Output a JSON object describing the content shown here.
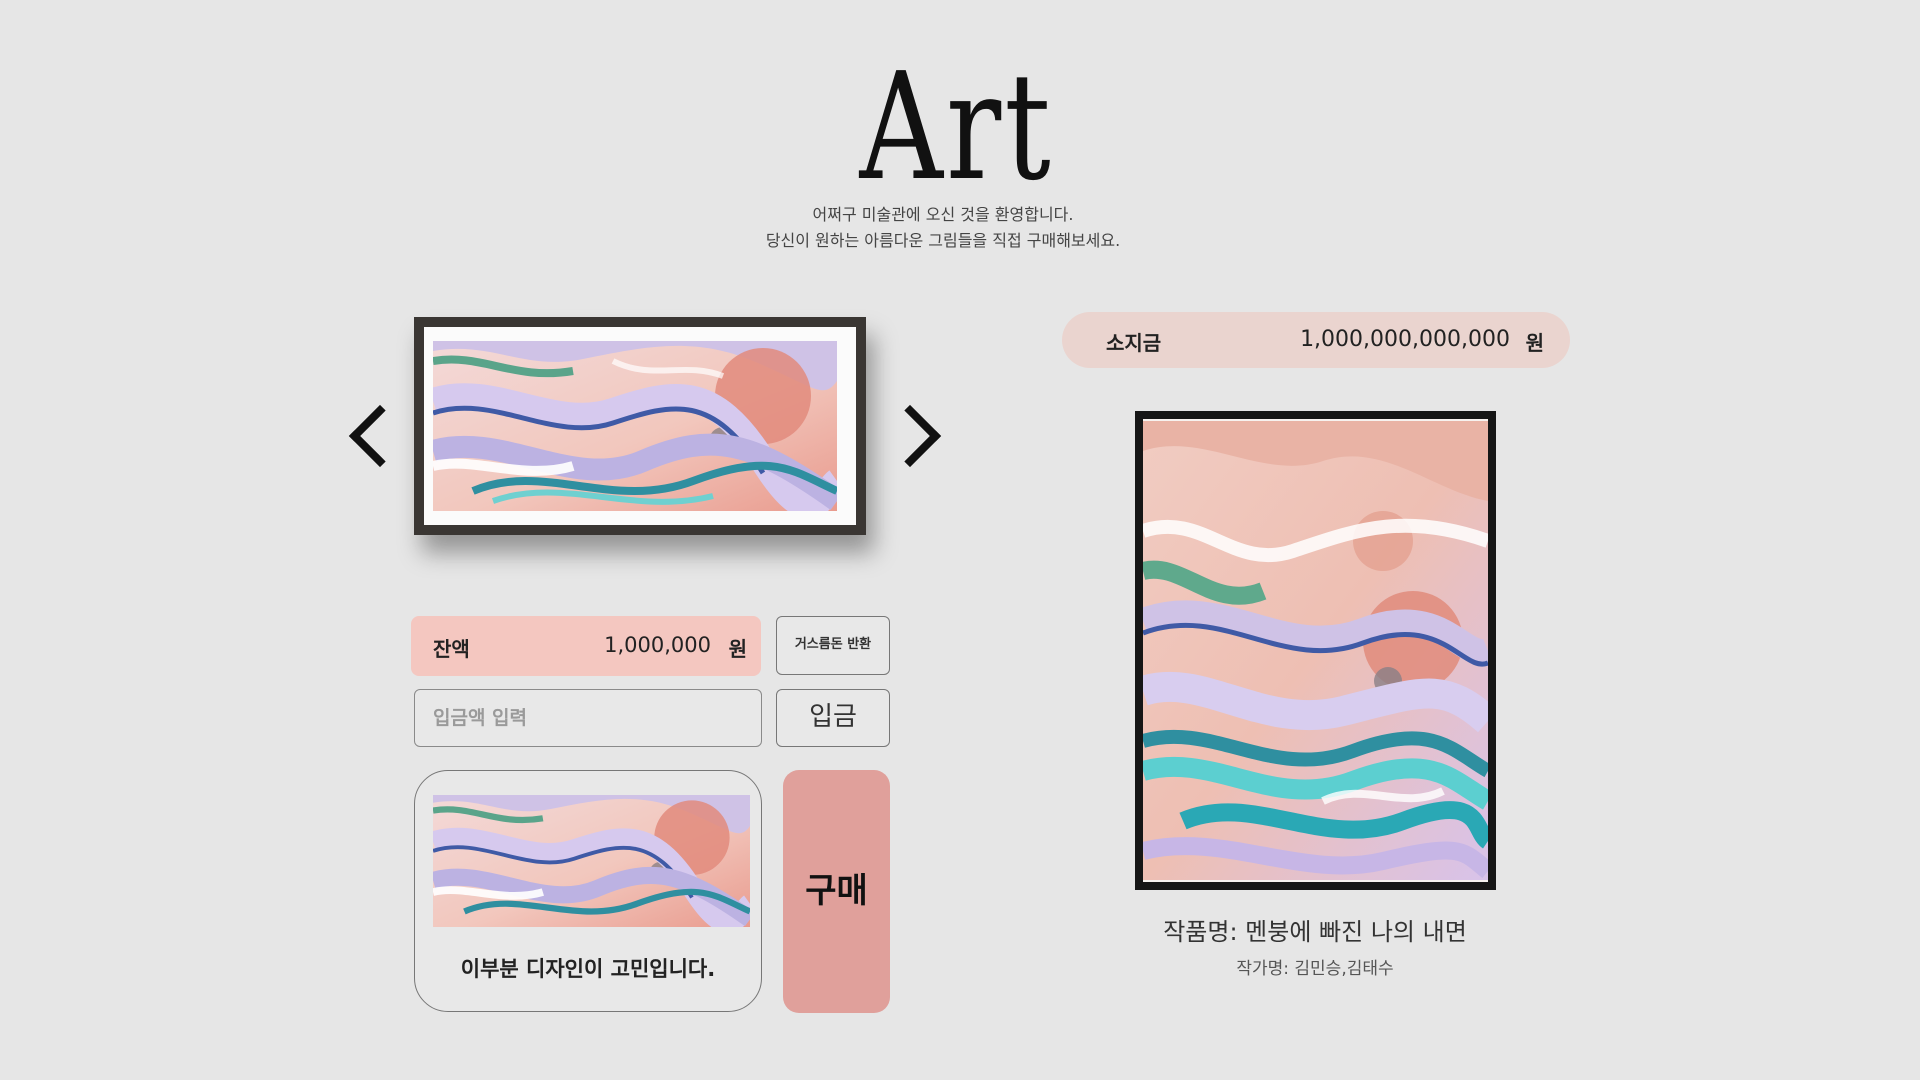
{
  "header": {
    "logo": "Art",
    "intro_line1": "어쩌구 미술관에 오신 것을 환영합니다.",
    "intro_line2": "당신이 원하는 아름다운 그림들을 직접 구매해보세요."
  },
  "carousel": {
    "prev_icon": "chevron-left-icon",
    "next_icon": "chevron-right-icon"
  },
  "balance": {
    "label": "잔액",
    "value": "1,000,000",
    "unit": "원"
  },
  "change_button": "거스름돈 반환",
  "deposit": {
    "placeholder": "입금액 입력",
    "button": "입금"
  },
  "cart": {
    "text": "이부분 디자인이 고민입니다."
  },
  "buy_button": "구매",
  "wallet": {
    "label": "소지금",
    "value": "1,000,000,000,000",
    "unit": "원"
  },
  "artwork": {
    "title": "작품명: 멘붕에 빠진 나의 내면",
    "artist": "작가명: 김민승,김태수"
  },
  "colors": {
    "background": "#e6e6e6",
    "balance_bg": "#f4c7c0",
    "wallet_bg": "#ead4cf",
    "buy_bg": "#e0a09b"
  }
}
